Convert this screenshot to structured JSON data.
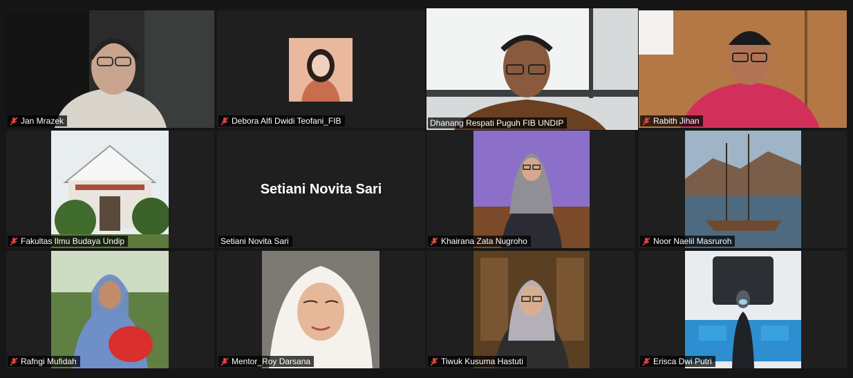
{
  "meeting": {
    "participants": [
      {
        "name": "Jan Mrazek",
        "muted": true
      },
      {
        "name": "Debora Alfi Dwidi Teofani_FIB",
        "muted": true
      },
      {
        "name": "Dhanang Respati Puguh FIB UNDIP",
        "muted": false,
        "active_speaker": true
      },
      {
        "name": "Rabith Jihan",
        "muted": true
      },
      {
        "name": "Fakultas Ilmu Budaya Undip",
        "muted": true
      },
      {
        "name": "Setiani Novita Sari",
        "muted": false,
        "display_text": "Setiani Novita Sari"
      },
      {
        "name": "Khairana Zata Nugroho",
        "muted": true
      },
      {
        "name": "Noor Naelil Masruroh",
        "muted": true
      },
      {
        "name": "Rafngi Mufidah",
        "muted": true
      },
      {
        "name": "Mentor_Roy Darsana",
        "muted": true
      },
      {
        "name": "Tiwuk Kusuma Hastuti",
        "muted": true
      },
      {
        "name": "Erisca Dwi Putri",
        "muted": true
      }
    ]
  },
  "colors": {
    "background": "#161616",
    "tile": "#1f1f1f",
    "active_border": "#b5e24a",
    "mute_icon": "#e0463c"
  },
  "icons": {
    "mute": "microphone-muted-icon"
  }
}
